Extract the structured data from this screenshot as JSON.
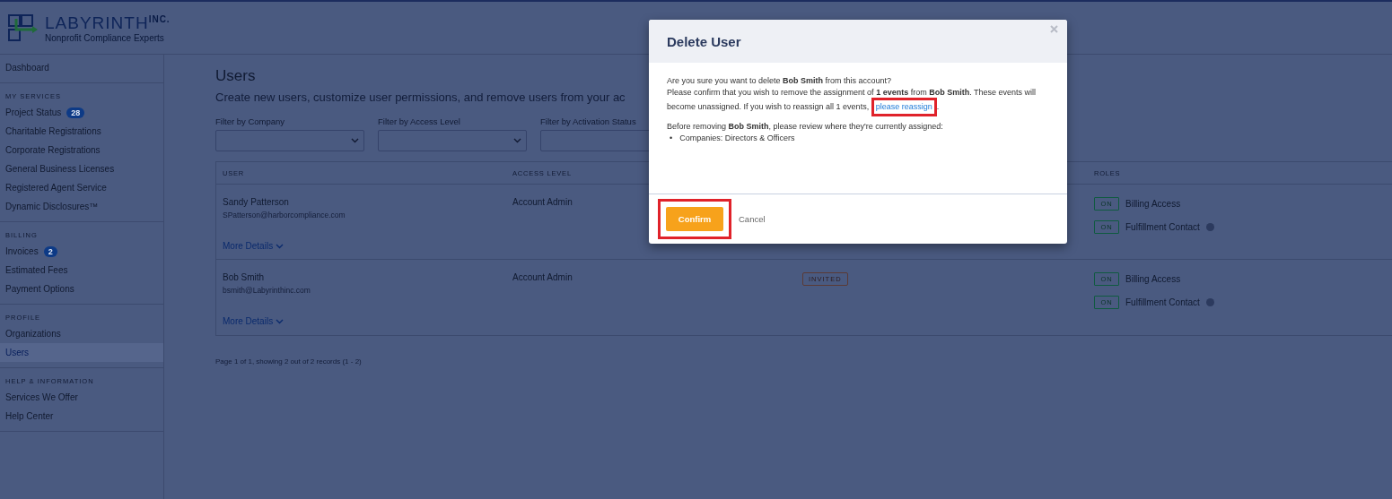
{
  "logo": {
    "name": "LABYRINTH",
    "suffix": "INC.",
    "tagline": "Nonprofit Compliance Experts"
  },
  "sidebar": {
    "sections": [
      {
        "items": [
          {
            "label": "Dashboard",
            "selected": false
          }
        ]
      },
      {
        "heading": "MY SERVICES",
        "items": [
          {
            "label": "Project Status",
            "badge": "28",
            "selected": false
          },
          {
            "label": "Charitable Registrations",
            "selected": false
          },
          {
            "label": "Corporate Registrations",
            "selected": false
          },
          {
            "label": "General Business Licenses",
            "selected": false
          },
          {
            "label": "Registered Agent Service",
            "selected": false
          },
          {
            "label": "Dynamic Disclosures™",
            "selected": false
          }
        ]
      },
      {
        "heading": "BILLING",
        "items": [
          {
            "label": "Invoices",
            "badge": "2",
            "selected": false
          },
          {
            "label": "Estimated Fees",
            "selected": false
          },
          {
            "label": "Payment Options",
            "selected": false
          }
        ]
      },
      {
        "heading": "PROFILE",
        "items": [
          {
            "label": "Organizations",
            "selected": false
          },
          {
            "label": "Users",
            "selected": true
          }
        ]
      },
      {
        "heading": "HELP & INFORMATION",
        "items": [
          {
            "label": "Services We Offer",
            "selected": false
          },
          {
            "label": "Help Center",
            "selected": false
          }
        ]
      }
    ]
  },
  "page": {
    "title": "Users",
    "subtitle": "Create new users, customize user permissions, and remove users from your ac",
    "filters": [
      {
        "label": "Filter by Company"
      },
      {
        "label": "Filter by Access Level"
      },
      {
        "label": "Filter by Activation Status"
      }
    ],
    "table": {
      "columns": [
        "USER",
        "ACCESS LEVEL",
        "ROLES"
      ],
      "rows": [
        {
          "name": "Sandy Patterson",
          "email": "SPatterson@harborcompliance.com",
          "access": "Account Admin",
          "more": "More Details",
          "roles": [
            {
              "toggle": "ON",
              "on": true,
              "label": "Billing Access",
              "help": false
            },
            {
              "toggle": "ON",
              "on": true,
              "label": "Fulfillment Contact",
              "help": true
            }
          ]
        },
        {
          "name": "Bob Smith",
          "email": "bsmith@Labyrinthinc.com",
          "access": "Account Admin",
          "status": "INVITED",
          "more": "More Details",
          "roles": [
            {
              "toggle": "ON",
              "on": true,
              "label": "Billing Access",
              "help": false
            },
            {
              "toggle": "ON",
              "on": true,
              "label": "Fulfillment Contact",
              "help": true
            }
          ]
        }
      ]
    },
    "pagination": "Page 1 of 1, showing 2 out of 2 records (1 - 2)"
  },
  "modal": {
    "title": "Delete User",
    "paragraph_1": "Are you sure you want to delete **Bob Smith** from this account?",
    "paragraph_2": "Please confirm that you wish to remove the assignment of **1 events** from **Bob Smith**. These events will become unassigned. If you wish to reassign all 1 events,",
    "link": {
      "label": "please reassign",
      "highlighted": true
    },
    "link_after": ".",
    "paragraph_3": "Before removing **Bob Smith**, please review where they're currently assigned:",
    "list": [
      {
        "bullet": "•",
        "text": "Companies: Directors & Officers"
      }
    ],
    "confirm": {
      "label": "Confirm",
      "highlighted": true
    },
    "cancel": "Cancel"
  }
}
